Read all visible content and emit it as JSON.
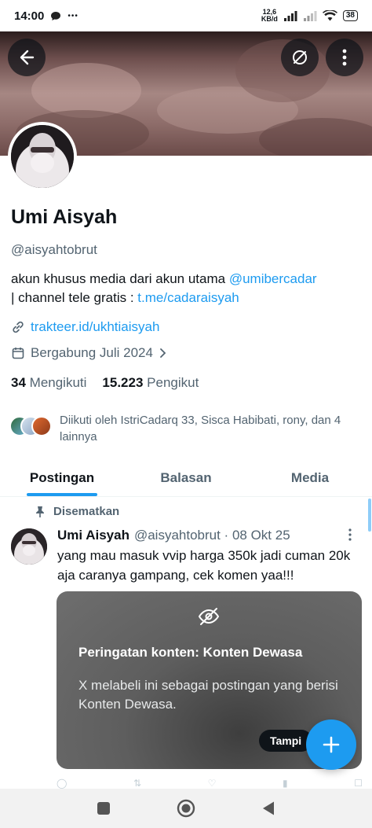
{
  "status_bar": {
    "time": "14:00",
    "speed_top": "12,6",
    "speed_bottom": "KB/d",
    "battery": "38",
    "more": "•••"
  },
  "header": {
    "back_icon": "arrow-left-icon",
    "hidden_icon": "eye-off-icon",
    "more_icon": "more-vertical-icon"
  },
  "profile": {
    "name": "Umi Aisyah",
    "handle": "@aisyahtobrut",
    "bio_text_1": "akun khusus media dari akun utama ",
    "bio_mention": "@umibercadar",
    "bio_text_2": "| channel tele gratis : ",
    "bio_link": "t.me/cadaraisyah",
    "website": "trakteer.id/ukhtiaisyah",
    "joined": "Bergabung Juli 2024",
    "following_count": "34",
    "following_label": "Mengikuti",
    "followers_count": "15.223",
    "followers_label": "Pengikut",
    "followed_by": "Diikuti oleh IstriCadarq 33, Sisca Habibati, rony, dan 4 lainnya"
  },
  "tabs": [
    {
      "label": "Postingan",
      "active": true
    },
    {
      "label": "Balasan",
      "active": false
    },
    {
      "label": "Media",
      "active": false
    }
  ],
  "tweet": {
    "pinned_label": "Disematkan",
    "name": "Umi Aisyah",
    "handle_date": "@aisyahtobrut · 08 Okt 25",
    "text": "yang mau masuk vvip harga 350k jadi cuman 20k aja caranya gampang, cek komen yaa!!!",
    "media_warning_title": "Peringatan konten: Konten Dewasa",
    "media_warning_desc": "X melabeli ini sebagai postingan yang berisi Konten Dewasa.",
    "show_button": "Tampi"
  },
  "colors": {
    "accent": "#1d9bf0",
    "text": "#0f1419",
    "secondary": "#536471"
  }
}
